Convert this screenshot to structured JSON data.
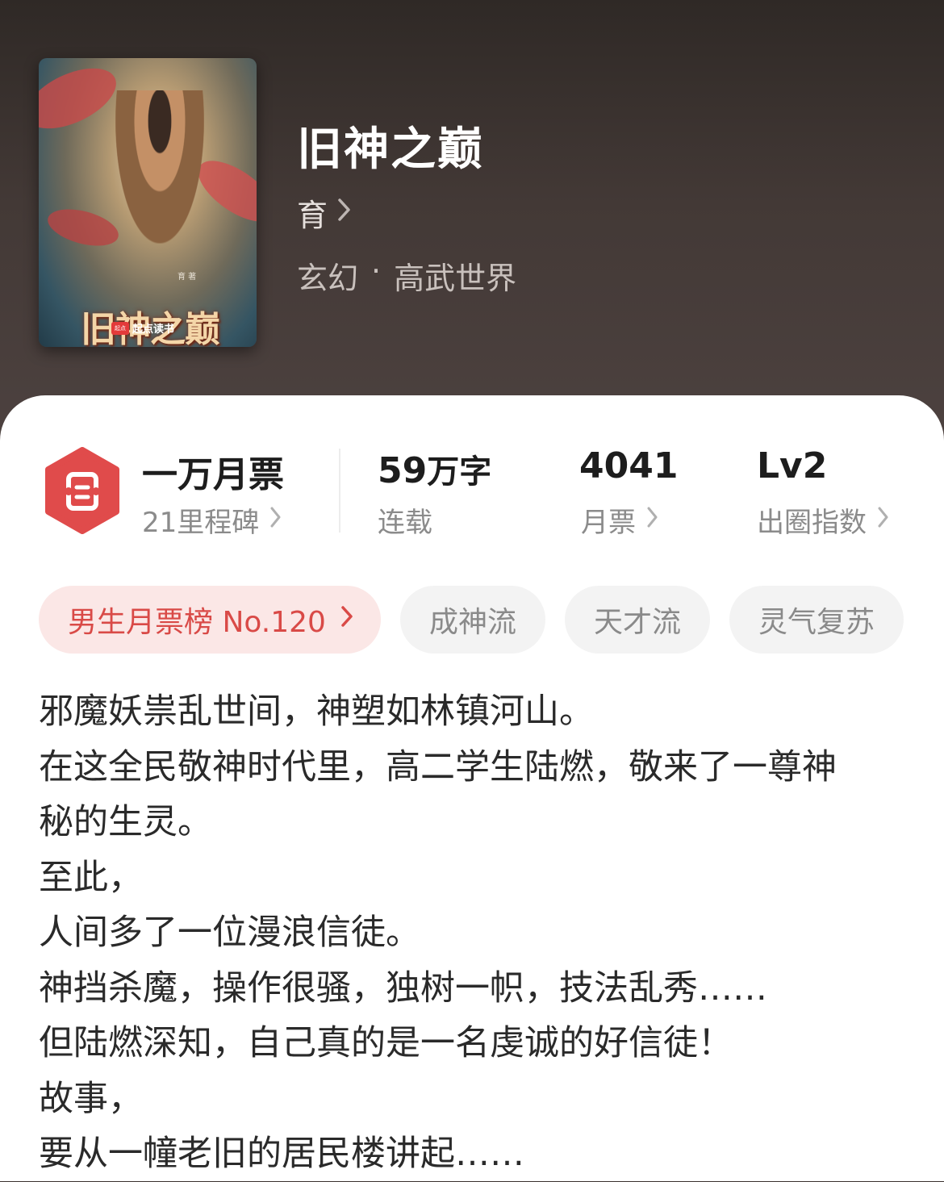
{
  "book": {
    "title": "旧神之巅",
    "author": "育",
    "genre": "玄幻",
    "subgenre": "高武世界",
    "genre_separator": "·"
  },
  "cover": {
    "title": "旧神之巅",
    "author_credit": "育 著",
    "publisher": "起点读书",
    "publisher_logo": "起点"
  },
  "stats": {
    "milestone": {
      "title": "一万月票",
      "subtitle": "21里程碑"
    },
    "word_count": {
      "value": "59",
      "unit": "万字",
      "label": "连载"
    },
    "monthly_tickets": {
      "value": "4041",
      "label": "月票"
    },
    "popularity": {
      "value": "Lv2",
      "label": "出圈指数"
    }
  },
  "tags": {
    "rank": "男生月票榜 No.120",
    "items": [
      "成神流",
      "天才流",
      "灵气复苏"
    ]
  },
  "description": [
    "邪魔妖祟乱世间，神塑如林镇河山。",
    "在这全民敬神时代里，高二学生陆燃，敬来了一尊神",
    "秘的生灵。",
    "至此，",
    "人间多了一位漫浪信徒。",
    "神挡杀魔，操作很骚，独树一帜，技法乱秀……",
    "但陆燃深知，自己真的是一名虔诚的好信徒！",
    "故事，",
    "要从一幢老旧的居民楼讲起……"
  ],
  "colors": {
    "header_bg": "#433936",
    "accent_red": "#e04b4b",
    "rank_tag_bg": "#fbe7e6",
    "rank_tag_text": "#d94a47",
    "tag_bg": "#f3f3f3"
  }
}
